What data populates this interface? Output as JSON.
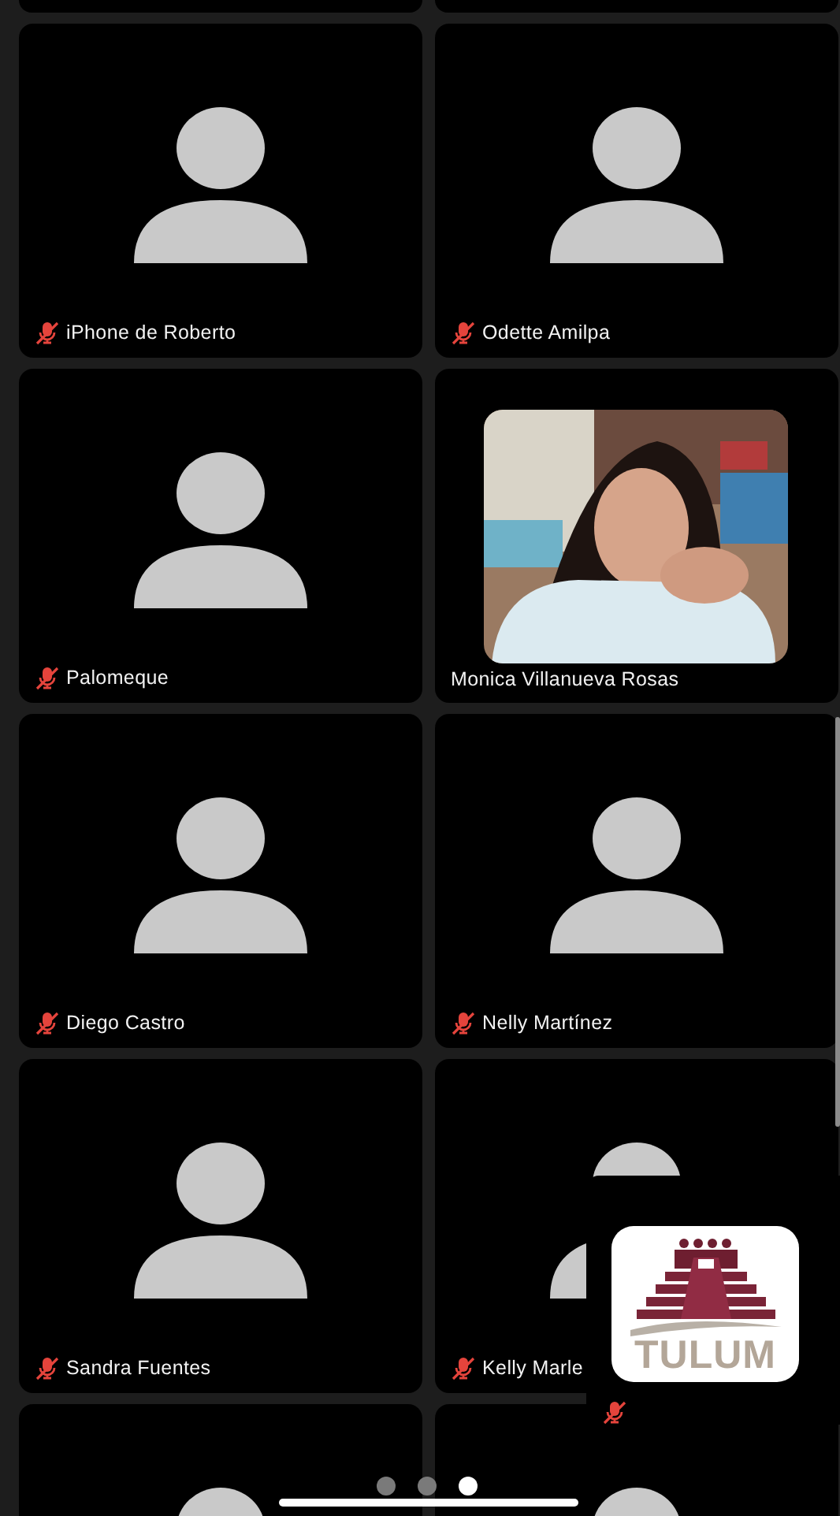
{
  "participants": [
    {
      "name": "iPhone de Roberto",
      "muted": true,
      "kind": "avatar"
    },
    {
      "name": "Odette Amilpa",
      "muted": true,
      "kind": "avatar"
    },
    {
      "name": "Palomeque",
      "muted": true,
      "kind": "avatar"
    },
    {
      "name": "Monica Villanueva Rosas",
      "muted": false,
      "kind": "picture"
    },
    {
      "name": "Diego Castro",
      "muted": true,
      "kind": "avatar"
    },
    {
      "name": "Nelly Martínez",
      "muted": true,
      "kind": "avatar"
    },
    {
      "name": "Sandra Fuentes",
      "muted": true,
      "kind": "avatar"
    },
    {
      "name": "Kelly Marle",
      "muted": true,
      "kind": "avatar"
    },
    {
      "kind": "avatar"
    },
    {
      "kind": "avatar"
    }
  ],
  "self_view": {
    "logo": "TULUM",
    "muted": true
  },
  "pager": [
    {
      "selected": false
    },
    {
      "selected": false
    },
    {
      "selected": true
    }
  ]
}
